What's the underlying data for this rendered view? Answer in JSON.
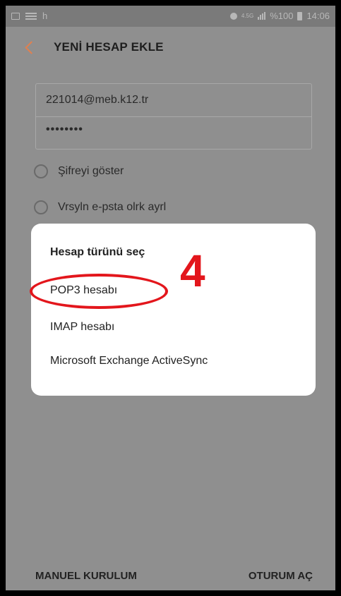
{
  "statusbar": {
    "carrier": "h",
    "network_badge": "4.5G",
    "battery_percent": "%100",
    "time": "14:06"
  },
  "appbar": {
    "title": "YENİ HESAP EKLE"
  },
  "form": {
    "email_value": "221014@meb.k12.tr",
    "password_value": "••••••••",
    "option1_label": "Şifreyi göster",
    "option2_label": "Vrsyln e-psta olrk ayrl"
  },
  "dialog": {
    "title": "Hesap türünü seç",
    "items": [
      "POP3 hesabı",
      "IMAP hesabı",
      "Microsoft Exchange ActiveSync"
    ]
  },
  "annotation": {
    "step_number": "4",
    "color": "#e3161c"
  },
  "bottom": {
    "left_button": "MANUEL KURULUM",
    "right_button": "OTURUM AÇ"
  }
}
